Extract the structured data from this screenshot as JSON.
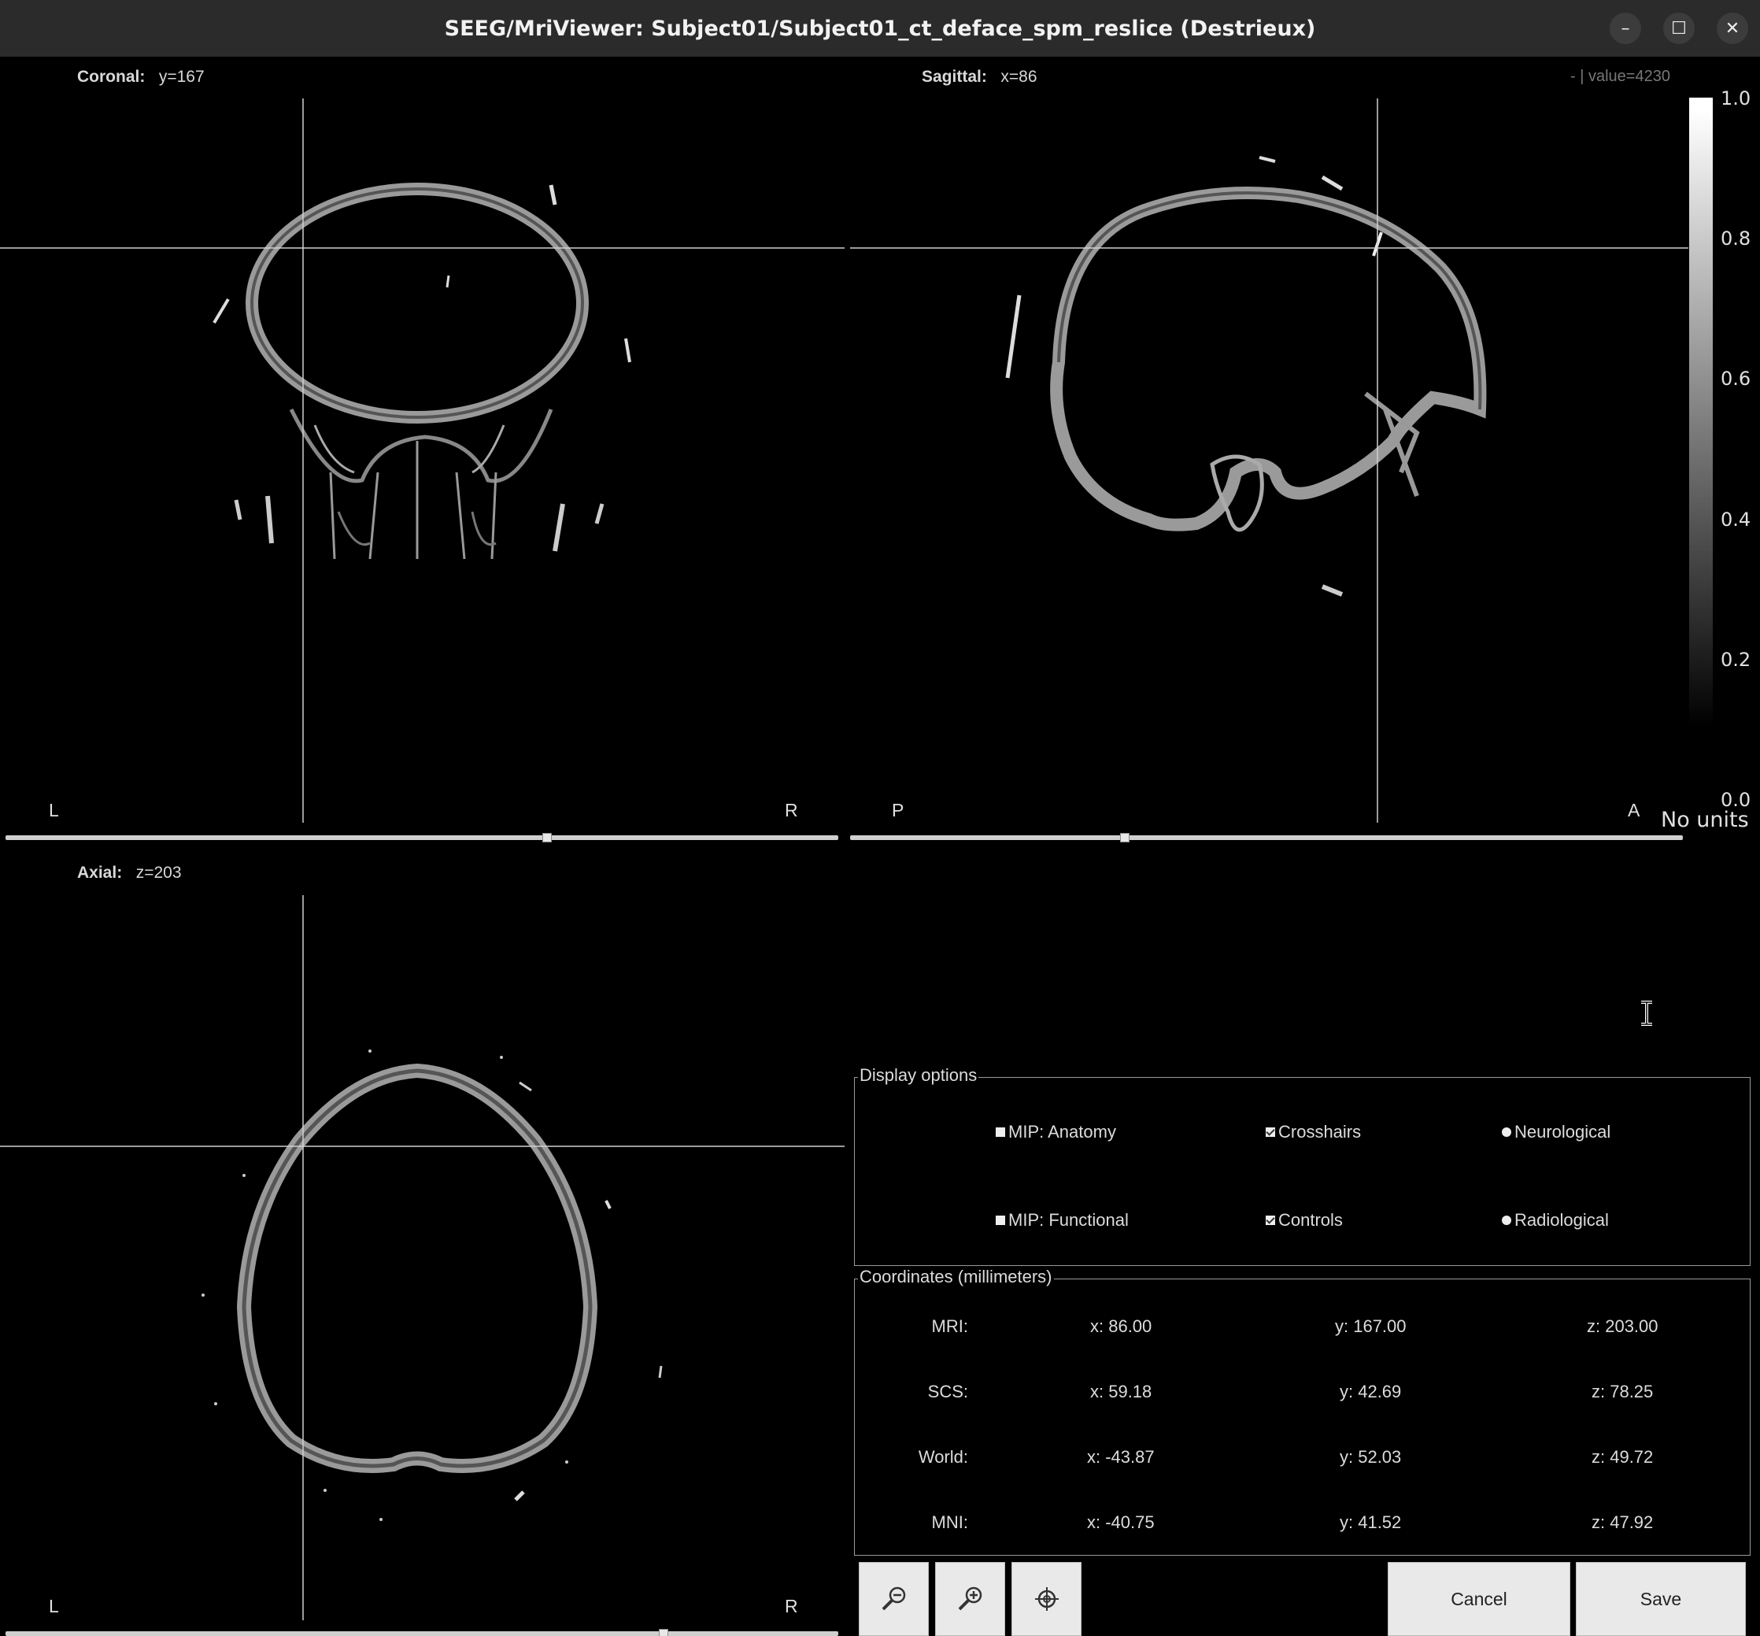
{
  "window": {
    "title": "SEEG/MriViewer: Subject01/Subject01_ct_deface_spm_reslice (Destrieux)",
    "minimize_icon": "minimize-icon",
    "maximize_icon": "maximize-icon",
    "close_icon": "close-icon"
  },
  "views": {
    "coronal": {
      "name": "Coronal",
      "value": "y=167",
      "left_dir": "L",
      "right_dir": "R",
      "slider_position": 0.65
    },
    "sagittal": {
      "name": "Sagittal",
      "value": "x=86",
      "left_dir": "P",
      "right_dir": "A",
      "slider_position": 0.33
    },
    "axial": {
      "name": "Axial",
      "value": "z=203",
      "left_dir": "L",
      "right_dir": "R",
      "slider_position": 0.79
    },
    "value_readout": "-  |  value=4230"
  },
  "colorbar": {
    "ticks": [
      "1.0",
      "0.8",
      "0.6",
      "0.4",
      "0.2",
      "0.0"
    ],
    "units": "No units"
  },
  "display_options": {
    "title": "Display options",
    "mip_anatomy": {
      "label": "MIP: Anatomy",
      "checked": false
    },
    "crosshairs": {
      "label": "Crosshairs",
      "checked": true
    },
    "neurological": {
      "label": "Neurological",
      "selected": true
    },
    "mip_functional": {
      "label": "MIP: Functional",
      "checked": false
    },
    "controls": {
      "label": "Controls",
      "checked": true
    },
    "radiological": {
      "label": "Radiological",
      "selected": false
    }
  },
  "coordinates": {
    "title": "Coordinates (millimeters)",
    "rows": [
      {
        "label": "MRI:",
        "x": "x: 86.00",
        "y": "y: 167.00",
        "z": "z: 203.00"
      },
      {
        "label": "SCS:",
        "x": "x: 59.18",
        "y": "y: 42.69",
        "z": "z: 78.25"
      },
      {
        "label": "World:",
        "x": "x: -43.87",
        "y": "y: 52.03",
        "z": "z: 49.72"
      },
      {
        "label": "MNI:",
        "x": "x: -40.75",
        "y": "y: 41.52",
        "z": "z: 47.92"
      }
    ]
  },
  "buttons": {
    "zoom_out_icon": "zoom-out-icon",
    "zoom_in_icon": "zoom-in-icon",
    "center_icon": "crosshair-target-icon",
    "cancel": "Cancel",
    "save": "Save"
  }
}
